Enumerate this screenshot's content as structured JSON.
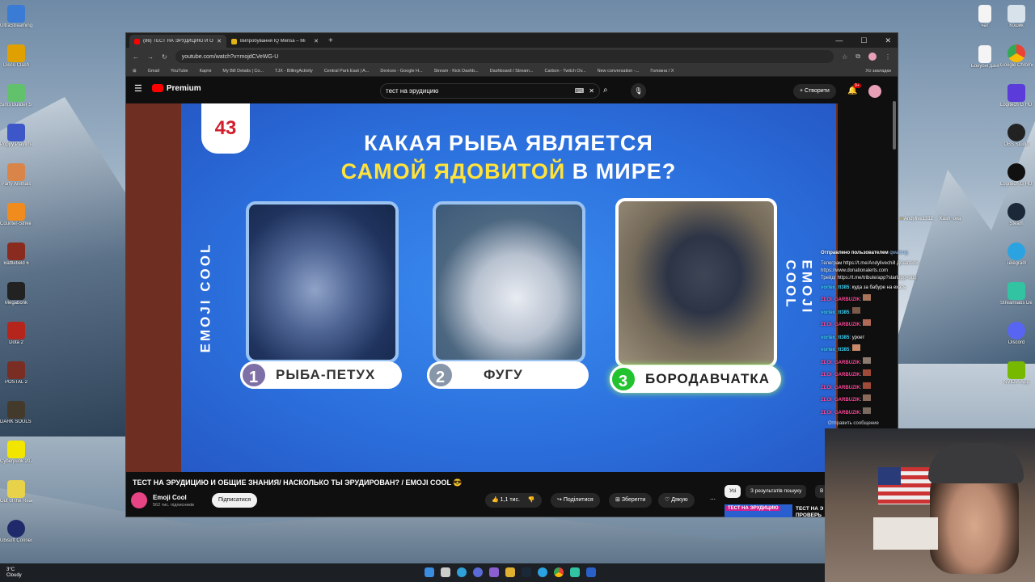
{
  "desktop": {
    "left_icons": [
      "UltraStreaming Kit",
      "Disco Clash",
      "Sims Builder Story",
      "Poppy Playtime",
      "Party Animals",
      "Counter-Strike 2",
      "Battlefield 6",
      "Megabonk",
      "Dota 2",
      "POSTAL 2",
      "DARK SOULS III",
      "Cyberpunk 2077",
      "Out of the Reach",
      "Ubisoft Connect"
    ],
    "right_icons": [
      "Кошик",
      "Google Chrome",
      "Logitech G HUB",
      "OBS Studio",
      "Logitech G HUB",
      "Steam",
      "Telegram",
      "Streamlabs Desktop",
      "Discord",
      "NVIDIA App"
    ],
    "top_file_icons": [
      "чат",
      "Бонусні дані"
    ]
  },
  "browser": {
    "tabs": [
      {
        "label": "(86) ТЕСТ НА ЭРУДИЦИЮ И О",
        "active": true
      },
      {
        "label": "Випробування IQ Mensa – Mi",
        "active": false
      }
    ],
    "url": "youtube.com/watch?v=mojdCVeWG-U",
    "bookmarks": [
      "Gmail",
      "YouTube",
      "Карти",
      "My Bill Details | Co...",
      "TJX - BillingActivity",
      "Central Park East | A...",
      "Devices - Google H...",
      "Stream - Kick Dashb...",
      "Dashboard / Stream...",
      "Carbon - Twitch Ov...",
      "New conversation -...",
      "Головна / X",
      "Усі закладки"
    ]
  },
  "youtube": {
    "logo": "Premium",
    "search_value": "тест на эрудицию",
    "create_label": "Створити",
    "notif_count": "9+",
    "video": {
      "question_number": "43",
      "question_line1": "КАКАЯ РЫБА ЯВЛЯЕТСЯ",
      "question_line2_highlight": "САМОЙ ЯДОВИТОЙ",
      "question_line2_rest": " В МИРЕ?",
      "watermark": "EMOJI COOL",
      "answers": [
        {
          "num": "1",
          "label": "РЫБА-ПЕТУХ"
        },
        {
          "num": "2",
          "label": "ФУГУ"
        },
        {
          "num": "3",
          "label": "БОРОДАВЧАТКА"
        }
      ]
    },
    "title": "ТЕСТ НА ЭРУДИЦИЮ И ОБЩИЕ ЗНАНИЯ/ НАСКОЛЬКО ТЫ ЭРУДИРОВАН? / EMOJI COOL 😎",
    "channel": "Emoji Cool",
    "subscribers": "562 тис. підписників",
    "subscribe_label": "Підписатися",
    "likes": "1,1 тис.",
    "share_label": "Поділитися",
    "save_label": "Зберегти",
    "thanks_label": "Дякую",
    "chips": [
      "Усі",
      "З результатів пошуку",
      "В"
    ],
    "next_video_thumb": "ТЕСТ НА ЭРУДИЦИЮ",
    "next_video_title": "ТЕСТ НА Э ПРОВЕРЬ"
  },
  "chat": {
    "top_users": [
      "Andylive1312",
      "Kash_ova"
    ],
    "lines": [
      {
        "user": "Отправлено пользователем",
        "text": " qwalong"
      },
      {
        "user": "",
        "text": "Телеграм https://t.me/Andylivechill Донатели https://www.donationalerts.com"
      },
      {
        "user": "",
        "text": "Трейдг https://t.me/tribute/app?startapp=sbg"
      },
      {
        "user": "vortex_tt385",
        "text": ": куда за бабуре на ехать"
      },
      {
        "user": "ZLOI_GARBUZIK",
        "text": ":"
      },
      {
        "user": "vortex_tt385",
        "text": ":"
      },
      {
        "user": "ZLOI_GARBUZIK",
        "text": ":"
      },
      {
        "user": "vortex_tt385",
        "text": ": уроет"
      },
      {
        "user": "vortex_tt385",
        "text": ":"
      },
      {
        "user": "ZLOI_GARBUZIK",
        "text": ":"
      },
      {
        "user": "ZLOI_GARBUZIK",
        "text": ":"
      },
      {
        "user": "ZLOI_GARBUZIK",
        "text": ":"
      },
      {
        "user": "ZLOI_GARBUZIK",
        "text": ":"
      },
      {
        "user": "ZLOI_GARBUZIK",
        "text": ":"
      }
    ],
    "input_placeholder": "Отправить сообщение"
  },
  "taskbar": {
    "weather_temp": "3°C",
    "weather_desc": "Cloudy"
  }
}
